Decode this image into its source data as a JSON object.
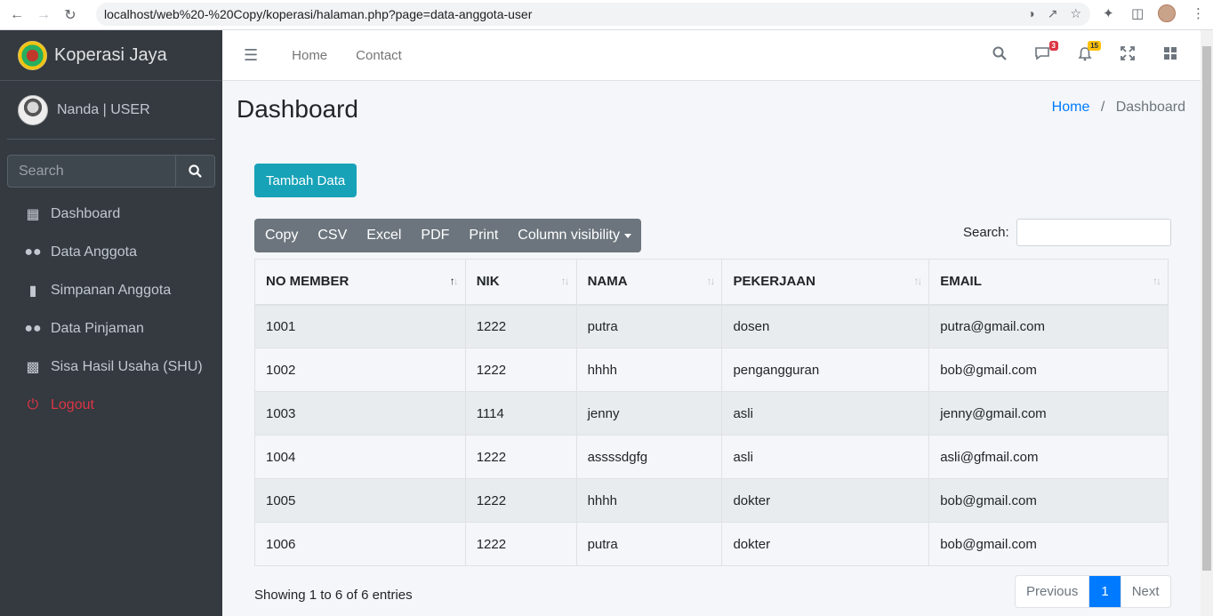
{
  "browser": {
    "url": "localhost/web%20-%20Copy/koperasi/halaman.php?page=data-anggota-user"
  },
  "sidebar": {
    "brand": "Koperasi Jaya",
    "user": "Nanda | USER",
    "search_placeholder": "Search",
    "items": [
      {
        "label": "Dashboard",
        "icon": "grid-icon"
      },
      {
        "label": "Data Anggota",
        "icon": "users-icon"
      },
      {
        "label": "Simpanan Anggota",
        "icon": "briefcase-icon"
      },
      {
        "label": "Data Pinjaman",
        "icon": "users-icon"
      },
      {
        "label": "Sisa Hasil Usaha (SHU)",
        "icon": "building-icon"
      },
      {
        "label": "Logout",
        "icon": "power-icon"
      }
    ]
  },
  "navbar": {
    "links": [
      "Home",
      "Contact"
    ],
    "messages_badge": "3",
    "notifications_badge": "15"
  },
  "content": {
    "title": "Dashboard",
    "breadcrumb": {
      "home": "Home",
      "current": "Dashboard"
    },
    "add_button": "Tambah Data",
    "export_buttons": [
      "Copy",
      "CSV",
      "Excel",
      "PDF",
      "Print",
      "Column visibility"
    ],
    "search_label": "Search:",
    "table": {
      "headers": [
        "NO MEMBER",
        "NIK",
        "NAMA",
        "PEKERJAAN",
        "EMAIL"
      ],
      "rows": [
        [
          "1001",
          "1222",
          "putra",
          "dosen",
          "putra@gmail.com"
        ],
        [
          "1002",
          "1222",
          "hhhh",
          "pengangguran",
          "bob@gmail.com"
        ],
        [
          "1003",
          "1114",
          "jenny",
          "asli",
          "jenny@gmail.com"
        ],
        [
          "1004",
          "1222",
          "assssdgfg",
          "asli",
          "asli@gfmail.com"
        ],
        [
          "1005",
          "1222",
          "hhhh",
          "dokter",
          "bob@gmail.com"
        ],
        [
          "1006",
          "1222",
          "putra",
          "dokter",
          "bob@gmail.com"
        ]
      ]
    },
    "info": "Showing 1 to 6 of 6 entries",
    "pagination": {
      "previous": "Previous",
      "page": "1",
      "next": "Next"
    }
  },
  "colors": {
    "sidebar_bg": "#343a40",
    "accent_info": "#17a2b8",
    "accent_primary": "#007bff",
    "danger": "#dc3545",
    "secondary": "#6c757d"
  }
}
